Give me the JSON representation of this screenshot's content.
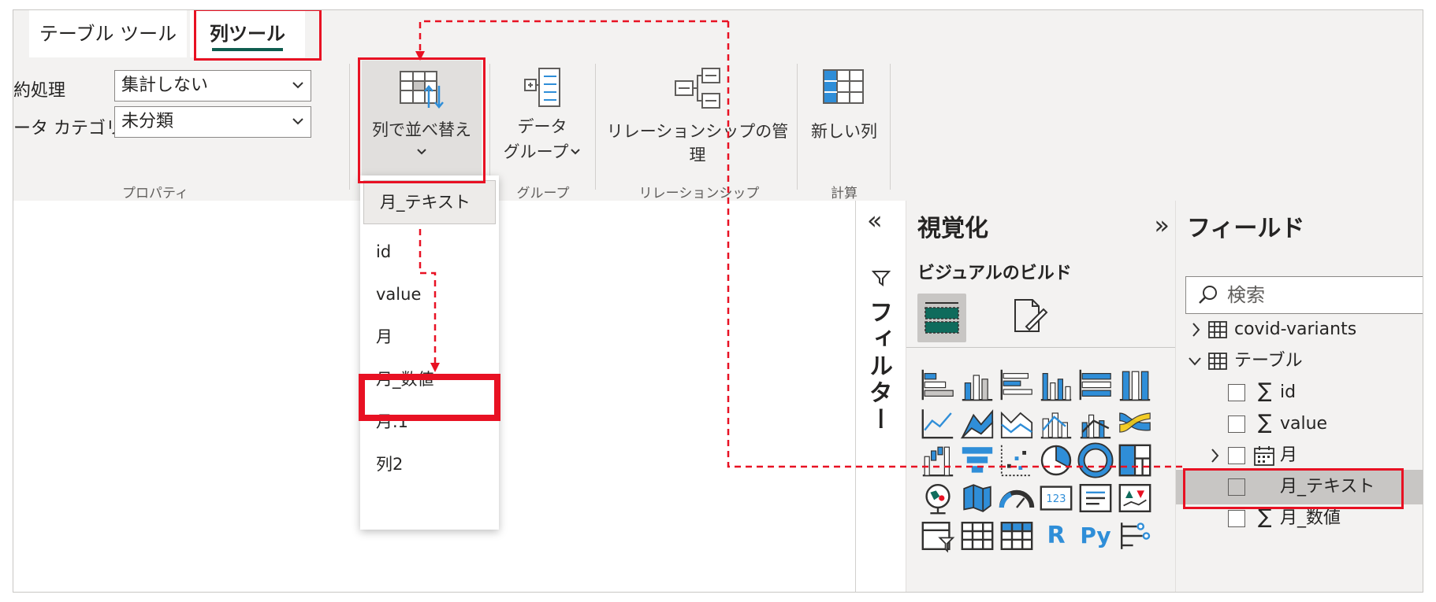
{
  "tabs": {
    "table_tools": "テーブル ツール",
    "column_tools": "列ツール"
  },
  "properties": {
    "summarization_label": "約処理",
    "summarization_value": "集計しない",
    "data_category_label": "ータ カテゴリ",
    "data_category_value": "未分類",
    "group_label": "プロパティ"
  },
  "sort_button": {
    "label": "列で並べ替え",
    "chevron": "⌄"
  },
  "data_group": {
    "label_line1": "データ",
    "label_line2": "グループ",
    "chevron": "⌄",
    "group_label": "グループ"
  },
  "relationship": {
    "label": "リレーションシップの管理",
    "group_label": "リレーションシップ"
  },
  "calc": {
    "label": "新しい列",
    "group_label": "計算"
  },
  "sort_menu": {
    "items": [
      "月_テキスト",
      "id",
      "value",
      "月",
      "月_数値",
      "月.1",
      "列2"
    ]
  },
  "filters_pane": {
    "collapse_glyph": "«",
    "title": "フィルター"
  },
  "visualizations_pane": {
    "title": "視覚化",
    "expand_glyph": "»",
    "subtitle": "ビジュアルのビルド",
    "r_label": "R",
    "py_label": "Py"
  },
  "fields_pane": {
    "title": "フィールド",
    "search_placeholder": "検索",
    "tables": [
      {
        "name": "covid-variants",
        "expanded": false
      },
      {
        "name": "テーブル",
        "expanded": true
      }
    ],
    "fields": [
      {
        "name": "id",
        "kind": "sigma"
      },
      {
        "name": "value",
        "kind": "sigma"
      },
      {
        "name": "月",
        "kind": "date"
      },
      {
        "name": "月_テキスト",
        "kind": "text"
      },
      {
        "name": "月_数値",
        "kind": "sigma"
      }
    ]
  },
  "colors": {
    "accent_red": "#e81123",
    "tab_underline": "#0e5d4f",
    "icon_blue": "#2f8ed8",
    "icon_green": "#0f6b5c"
  }
}
